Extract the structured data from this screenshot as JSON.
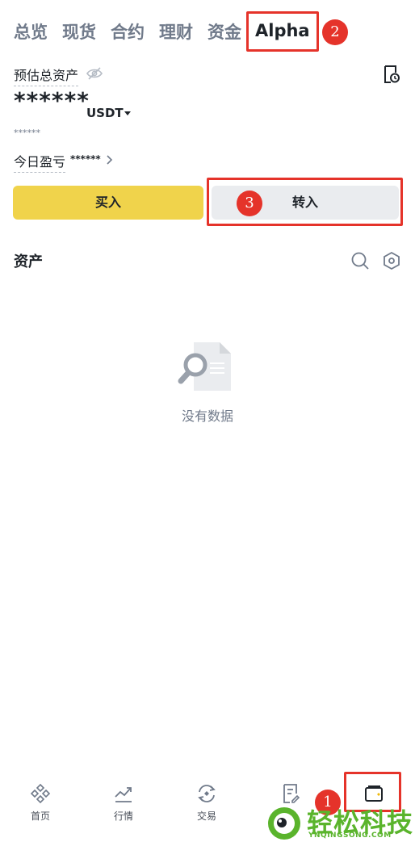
{
  "tabs": [
    {
      "label": "总览"
    },
    {
      "label": "现货"
    },
    {
      "label": "合约"
    },
    {
      "label": "理财"
    },
    {
      "label": "资金"
    },
    {
      "label": "Alpha"
    }
  ],
  "account": {
    "estimated_label": "预估总资产",
    "balance": "******",
    "currency": "USDT",
    "sub_value": "******",
    "pnl_label": "今日盈亏",
    "pnl_value": "******"
  },
  "actions": {
    "buy_label": "买入",
    "transfer_label": "转入"
  },
  "assets": {
    "title": "资产",
    "empty_text": "没有数据"
  },
  "bottom_nav": [
    {
      "label": "首页",
      "icon": "home-icon"
    },
    {
      "label": "行情",
      "icon": "markets-icon"
    },
    {
      "label": "交易",
      "icon": "trade-icon"
    },
    {
      "label": "",
      "icon": "orders-icon"
    },
    {
      "label": "",
      "icon": "wallet-icon"
    }
  ],
  "annotations": [
    "1",
    "2",
    "3"
  ],
  "watermark": {
    "text": "轻松科技",
    "domain": "YNQINGSONG.COM"
  },
  "colors": {
    "accent_yellow": "#f0d34b",
    "annotation_red": "#e5332a",
    "watermark_green": "#5ab42c"
  }
}
